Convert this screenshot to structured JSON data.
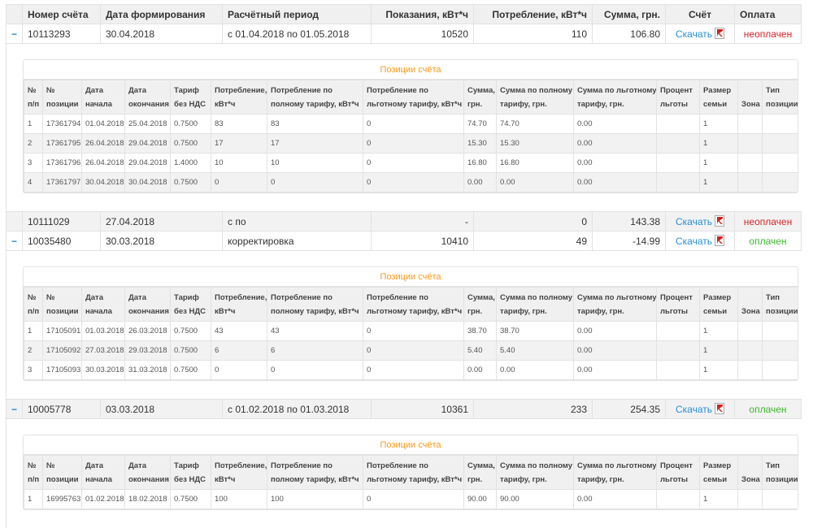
{
  "columns": [
    "",
    "Номер счёта",
    "Дата формирования",
    "Расчётный период",
    "Показания, кВт*ч",
    "Потребление, кВт*ч",
    "Сумма, грн.",
    "Счёт",
    "Оплата"
  ],
  "detail_title": "Позиции счёта",
  "detail_columns": [
    [
      "№",
      "п/п"
    ],
    [
      "№",
      "позиции"
    ],
    [
      "Дата",
      "начала"
    ],
    [
      "Дата",
      "окончания"
    ],
    [
      "Тариф",
      "без НДС"
    ],
    [
      "Потребление,",
      "кВт*ч"
    ],
    [
      "Потребление по",
      "полному тарифу, кВт*ч"
    ],
    [
      "Потребление по",
      "льготному тарифу, кВт*ч"
    ],
    [
      "Сумма,",
      "грн."
    ],
    [
      "Сумма по полному",
      "тарифу, грн."
    ],
    [
      "Сумма по льготному",
      "тарифу, грн."
    ],
    [
      "Процент",
      "льготы"
    ],
    [
      "Размер",
      "семьи"
    ],
    [
      "",
      "Зона"
    ],
    [
      "Тип",
      "позиции"
    ]
  ],
  "colors": {
    "unpaid": "#d8232a",
    "paid": "#3cb72c",
    "link": "#2a8fd0",
    "accent": "#f59a1a"
  },
  "invoices": [
    {
      "toggle": "−",
      "number": "10113293",
      "date": "30.04.2018",
      "period": "с 01.04.2018 по 01.05.2018",
      "reading": "10520",
      "consumption": "110",
      "sum": "106.80",
      "download": "Скачать",
      "status": "неоплачен",
      "status_type": "unpaid",
      "alt": false,
      "positions": [
        [
          "1",
          "17361794",
          "01.04.2018",
          "25.04.2018",
          "0.7500",
          "83",
          "83",
          "0",
          "74.70",
          "74.70",
          "0.00",
          "",
          "1",
          "",
          ""
        ],
        [
          "2",
          "17361795",
          "26.04.2018",
          "29.04.2018",
          "0.7500",
          "17",
          "17",
          "0",
          "15.30",
          "15.30",
          "0.00",
          "",
          "1",
          "",
          ""
        ],
        [
          "3",
          "17361796",
          "26.04.2018",
          "29.04.2018",
          "1.4000",
          "10",
          "10",
          "0",
          "16.80",
          "16.80",
          "0.00",
          "",
          "1",
          "",
          ""
        ],
        [
          "4",
          "17361797",
          "30.04.2018",
          "30.04.2018",
          "0.7500",
          "0",
          "0",
          "0",
          "0.00",
          "0.00",
          "0.00",
          "",
          "1",
          "",
          ""
        ]
      ]
    },
    {
      "toggle": "",
      "number": "10111029",
      "date": "27.04.2018",
      "period": "с по",
      "reading": "-",
      "consumption": "0",
      "sum": "143.38",
      "download": "Скачать",
      "status": "неоплачен",
      "status_type": "unpaid",
      "alt": true,
      "positions": null
    },
    {
      "toggle": "−",
      "number": "10035480",
      "date": "30.03.2018",
      "period": "корректировка",
      "reading": "10410",
      "consumption": "49",
      "sum": "-14.99",
      "download": "Скачать",
      "status": "оплачен",
      "status_type": "paid",
      "alt": false,
      "positions": [
        [
          "1",
          "17105091",
          "01.03.2018",
          "26.03.2018",
          "0.7500",
          "43",
          "43",
          "0",
          "38.70",
          "38.70",
          "0.00",
          "",
          "1",
          "",
          ""
        ],
        [
          "2",
          "17105092",
          "27.03.2018",
          "29.03.2018",
          "0.7500",
          "6",
          "6",
          "0",
          "5.40",
          "5.40",
          "0.00",
          "",
          "1",
          "",
          ""
        ],
        [
          "3",
          "17105093",
          "30.03.2018",
          "31.03.2018",
          "0.7500",
          "0",
          "0",
          "0",
          "0.00",
          "0.00",
          "0.00",
          "",
          "1",
          "",
          ""
        ]
      ]
    },
    {
      "toggle": "−",
      "number": "10005778",
      "date": "03.03.2018",
      "period": "с 01.02.2018 по 01.03.2018",
      "reading": "10361",
      "consumption": "233",
      "sum": "254.35",
      "download": "Скачать",
      "status": "оплачен",
      "status_type": "paid",
      "alt": true,
      "positions": [
        [
          "1",
          "16995763",
          "01.02.2018",
          "18.02.2018",
          "0.7500",
          "100",
          "100",
          "0",
          "90.00",
          "90.00",
          "0.00",
          "",
          "1",
          "",
          ""
        ]
      ]
    }
  ]
}
